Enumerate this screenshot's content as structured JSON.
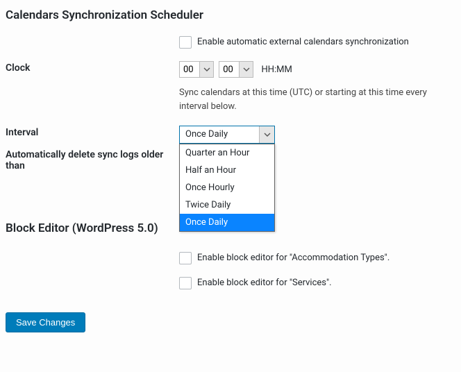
{
  "headings": {
    "scheduler": "Calendars Synchronization Scheduler",
    "block_editor": "Block Editor (WordPress 5.0)"
  },
  "enable_sync": {
    "label": "Enable automatic external calendars synchronization",
    "checked": false
  },
  "clock": {
    "label": "Clock",
    "hours_value": "00",
    "minutes_value": "00",
    "format_hint": "HH:MM",
    "help": "Sync calendars at this time (UTC) or starting at this time every interval below."
  },
  "interval": {
    "label": "Interval",
    "selected": "Once Daily",
    "options": [
      "Quarter an Hour",
      "Half an Hour",
      "Once Hourly",
      "Twice Daily",
      "Once Daily"
    ]
  },
  "auto_delete": {
    "label": "Automatically delete sync logs older than"
  },
  "block_editor_accom": {
    "label": "Enable block editor for \"Accommodation Types\".",
    "checked": false
  },
  "block_editor_services": {
    "label": "Enable block editor for \"Services\".",
    "checked": false
  },
  "buttons": {
    "save": "Save Changes"
  }
}
